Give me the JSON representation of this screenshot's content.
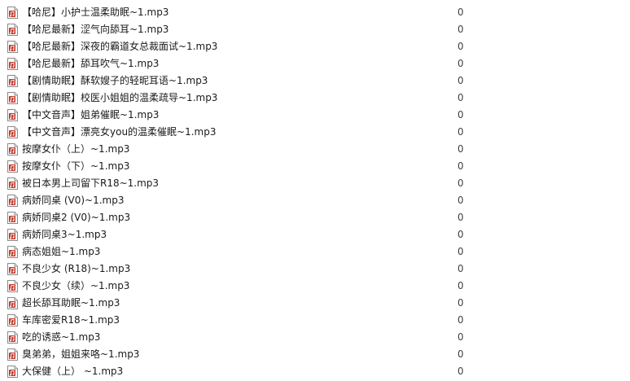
{
  "file_list": {
    "items": [
      {
        "name": "【哈尼】小护士温柔助眠~1.mp3",
        "count": "0",
        "icon": "mp3-file-icon"
      },
      {
        "name": "【哈尼最新】涩气向舔耳~1.mp3",
        "count": "0",
        "icon": "mp3-file-icon"
      },
      {
        "name": "【哈尼最新】深夜的霸道女总裁面试~1.mp3",
        "count": "0",
        "icon": "mp3-file-icon"
      },
      {
        "name": "【哈尼最新】舔耳吹气~1.mp3",
        "count": "0",
        "icon": "mp3-file-icon"
      },
      {
        "name": "【剧情助眠】酥软嫂子的轻昵耳语~1.mp3",
        "count": "0",
        "icon": "mp3-file-icon"
      },
      {
        "name": "【剧情助眠】校医小姐姐的温柔疏导~1.mp3",
        "count": "0",
        "icon": "mp3-file-icon"
      },
      {
        "name": "【中文音声】姐弟催眠~1.mp3",
        "count": "0",
        "icon": "mp3-file-icon"
      },
      {
        "name": "【中文音声】漂亮女you的温柔催眠~1.mp3",
        "count": "0",
        "icon": "mp3-file-icon"
      },
      {
        "name": "按摩女仆（上）~1.mp3",
        "count": "0",
        "icon": "mp3-file-icon"
      },
      {
        "name": "按摩女仆（下）~1.mp3",
        "count": "0",
        "icon": "mp3-file-icon"
      },
      {
        "name": "被日本男上司留下R18~1.mp3",
        "count": "0",
        "icon": "mp3-file-icon"
      },
      {
        "name": "病娇同桌 (V0)~1.mp3",
        "count": "0",
        "icon": "mp3-file-icon"
      },
      {
        "name": "病娇同桌2 (V0)~1.mp3",
        "count": "0",
        "icon": "mp3-file-icon"
      },
      {
        "name": "病娇同桌3~1.mp3",
        "count": "0",
        "icon": "mp3-file-icon"
      },
      {
        "name": "病态姐姐~1.mp3",
        "count": "0",
        "icon": "mp3-file-icon"
      },
      {
        "name": "不良少女 (R18)~1.mp3",
        "count": "0",
        "icon": "mp3-file-icon"
      },
      {
        "name": "不良少女（续）~1.mp3",
        "count": "0",
        "icon": "mp3-file-icon"
      },
      {
        "name": "超长舔耳助眠~1.mp3",
        "count": "0",
        "icon": "mp3-file-icon"
      },
      {
        "name": "车库密爱R18~1.mp3",
        "count": "0",
        "icon": "mp3-file-icon"
      },
      {
        "name": "吃的诱惑~1.mp3",
        "count": "0",
        "icon": "mp3-file-icon"
      },
      {
        "name": "臭弟弟，姐姐来咯~1.mp3",
        "count": "0",
        "icon": "mp3-file-icon"
      },
      {
        "name": "大保健（上） ~1.mp3",
        "count": "0",
        "icon": "mp3-file-icon"
      }
    ]
  },
  "colors": {
    "icon_accent": "#c0392b",
    "icon_border": "#8a8a8a",
    "text": "#1a1a1a"
  }
}
